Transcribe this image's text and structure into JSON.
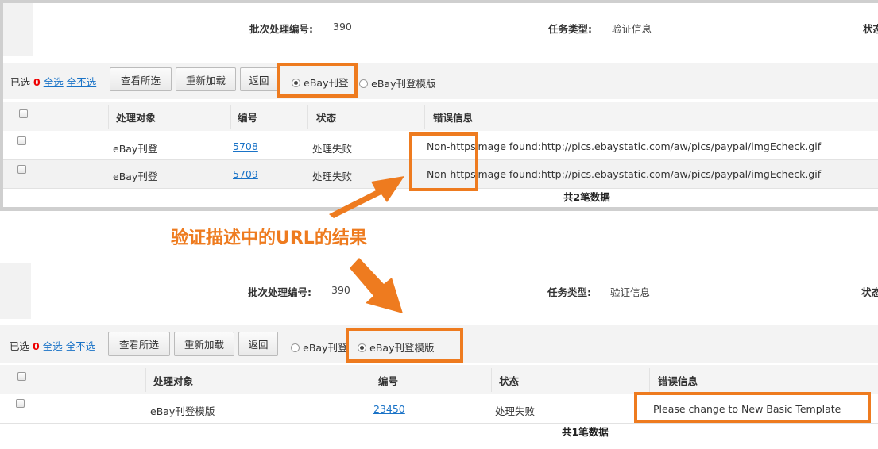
{
  "panel1": {
    "batch_label": "批次处理编号:",
    "batch_value": "390",
    "task_label": "任务类型:",
    "task_value": "验证信息",
    "cut_label": "状态",
    "selected_prefix": "已选",
    "selected_count": "0",
    "select_all": "全选",
    "select_none": "全不选",
    "btn_view": "查看所选",
    "btn_reload": "重新加载",
    "btn_back": "返回",
    "radio1": "eBay刊登",
    "radio2": "eBay刊登模版",
    "headers": [
      "处理对象",
      "编号",
      "状态",
      "错误信息"
    ],
    "rows": [
      {
        "obj": "eBay刊登",
        "id": "5708",
        "status": "处理失败",
        "err_a": "Non-https",
        "err_b": "image found:http://pics.ebaystatic.com/aw/pics/paypal/imgEcheck.gif"
      },
      {
        "obj": "eBay刊登",
        "id": "5709",
        "status": "处理失败",
        "err_a": "Non-https",
        "err_b": "image found:http://pics.ebaystatic.com/aw/pics/paypal/imgEcheck.gif"
      }
    ],
    "total": "共2笔数据"
  },
  "annotation": "验证描述中的URL的结果",
  "panel2": {
    "batch_label": "批次处理编号:",
    "batch_value": "390",
    "task_label": "任务类型:",
    "task_value": "验证信息",
    "cut_label": "状态",
    "selected_prefix": "已选",
    "selected_count": "0",
    "select_all": "全选",
    "select_none": "全不选",
    "btn_view": "查看所选",
    "btn_reload": "重新加载",
    "btn_back": "返回",
    "radio1": "eBay刊登",
    "radio2": "eBay刊登模版",
    "headers": [
      "处理对象",
      "编号",
      "状态",
      "错误信息"
    ],
    "rows": [
      {
        "obj": "eBay刊登模版",
        "id": "23450",
        "status": "处理失败",
        "err": "Please change to New Basic Template"
      }
    ],
    "total": "共1笔数据"
  },
  "colors": {
    "highlight": "#ee7b1f",
    "link": "#1a73c7",
    "count": "#ee0000"
  }
}
